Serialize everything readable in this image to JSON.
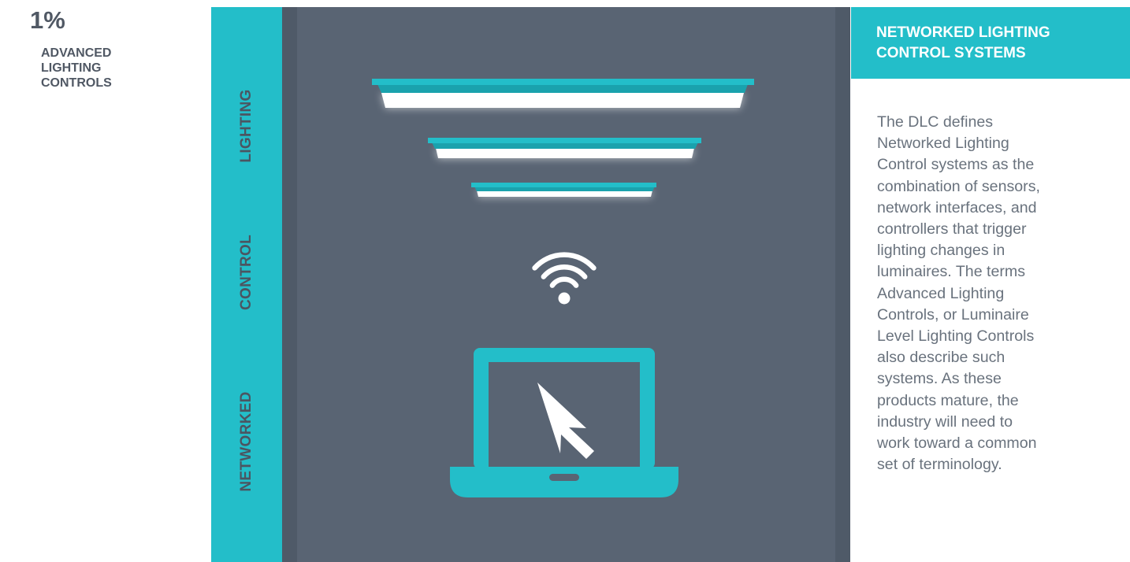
{
  "stat": {
    "value": "1%",
    "label_lines": [
      "ADVANCED",
      "LIGHTING",
      "CONTROLS"
    ]
  },
  "banner": {
    "words": [
      "LIGHTING",
      "CONTROL",
      "NETWORKED"
    ]
  },
  "illustration": {
    "icons": [
      "ceiling-light-icon",
      "wifi-icon",
      "laptop-icon",
      "cursor-arrow-icon"
    ]
  },
  "info": {
    "title_lines": [
      "NETWORKED LIGHTING",
      "CONTROL SYSTEMS"
    ],
    "body_lines": [
      "The DLC defines",
      "Networked Lighting",
      "Control systems as the",
      "combination of sensors,",
      "network interfaces, and",
      "controllers that trigger",
      "lighting changes in",
      "luminaires. The terms",
      "Advanced Lighting",
      "Controls, or Luminaire",
      "Level Lighting Controls",
      "also describe such",
      "systems. As these",
      "products mature, the",
      "industry will need to",
      "work toward a common",
      "set of terminology."
    ]
  },
  "colors": {
    "teal": "#23bec9",
    "panel": "#596473",
    "text_gray": "#69727d"
  }
}
